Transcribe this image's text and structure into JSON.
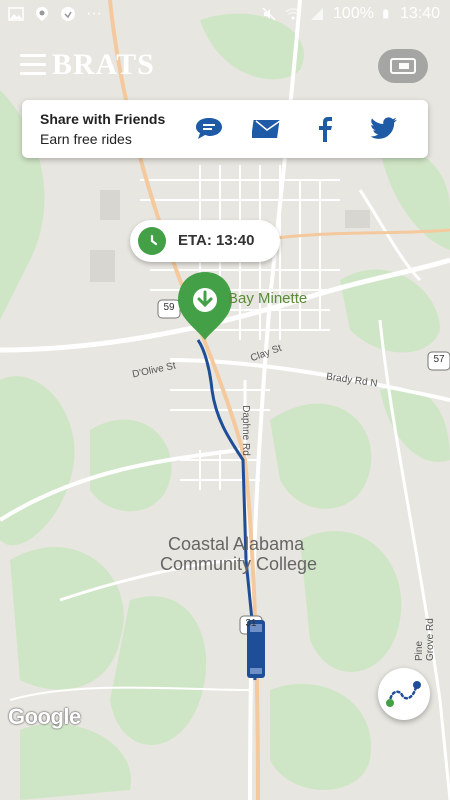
{
  "status_bar": {
    "battery": "100%",
    "time": "13:40",
    "dots": "···"
  },
  "header": {
    "brand": "BRATS"
  },
  "share": {
    "title": "Share with Friends",
    "subtitle": "Earn free rides",
    "icons": [
      "chat-icon",
      "email-icon",
      "facebook-icon",
      "twitter-icon"
    ]
  },
  "eta": {
    "label": "ETA: 13:40"
  },
  "map": {
    "labels": {
      "town": "Bay Minette",
      "college_1": "Coastal Alabama",
      "college_2": "Community College",
      "road_dolive": "D'Olive St",
      "road_clay": "Clay St",
      "road_brady": "Brady Rd N",
      "road_daphne": "Daphne Rd",
      "road_pine": "Pine Grove Rd",
      "shield_59": "59",
      "shield_57": "57",
      "shield_31": "31"
    },
    "attribution": "Google"
  },
  "colors": {
    "accent_green": "#43a047",
    "route_blue": "#1f4e99",
    "share_blue": "#1f5aa6"
  }
}
